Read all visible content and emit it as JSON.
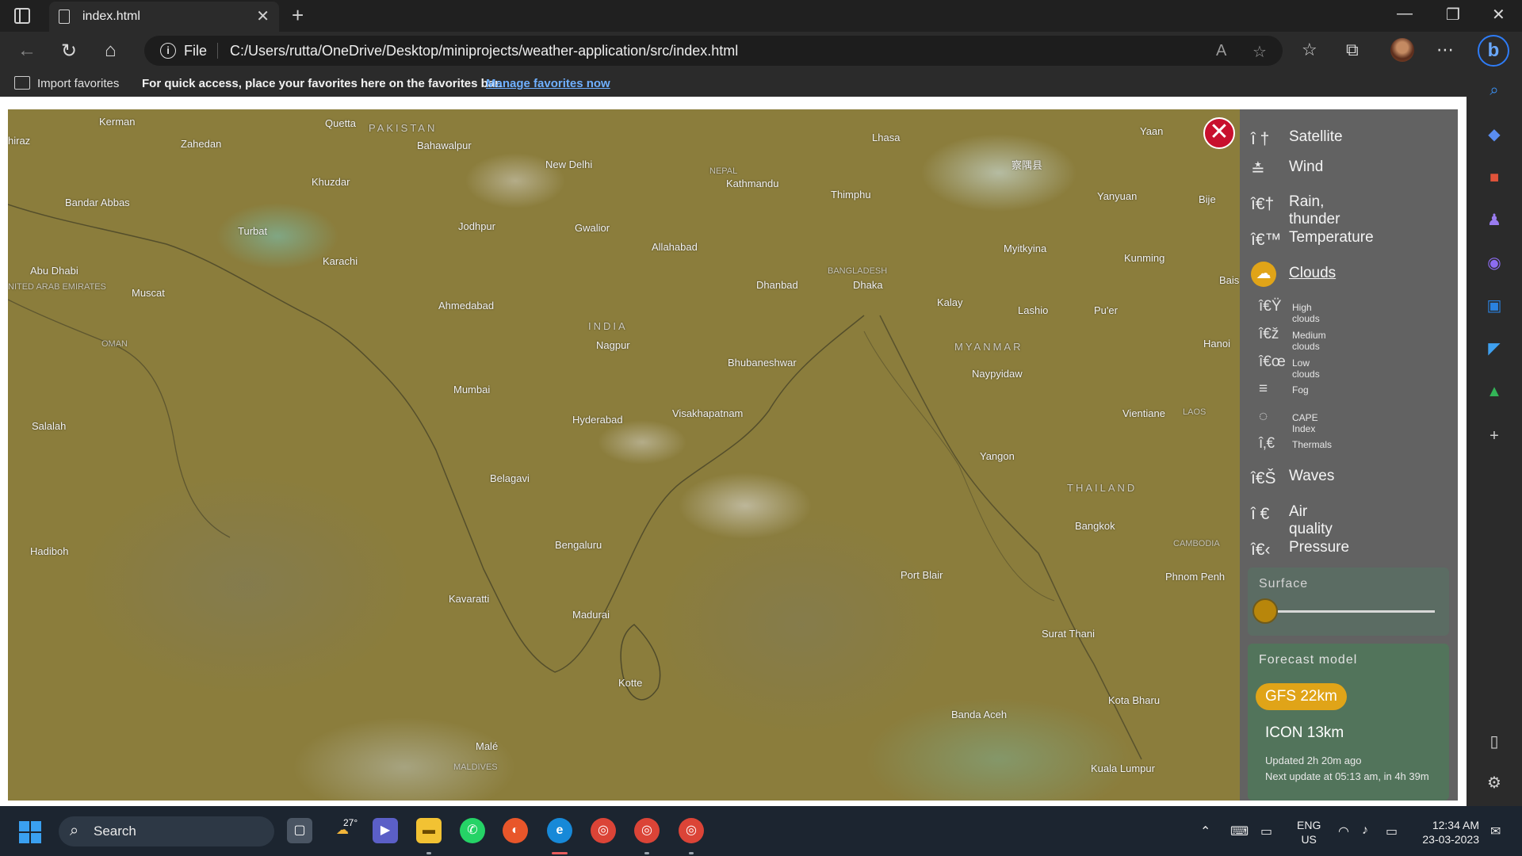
{
  "browser": {
    "tab_title": "index.html",
    "tab_close": "✕",
    "new_tab": "+",
    "window": {
      "minimize": "—",
      "restore": "❐",
      "close": "✕"
    },
    "address": {
      "scheme_label": "File",
      "url": "C:/Users/rutta/OneDrive/Desktop/miniprojects/weather-application/src/index.html"
    },
    "favorites_bar": {
      "import_label": "Import favorites",
      "message": "For quick access, place your favorites here on the favorites bar.",
      "manage_link": "Manage favorites now"
    }
  },
  "map": {
    "close_label": "✕",
    "labels": [
      {
        "text": "Kerman",
        "kind": "city"
      },
      {
        "text": "Quetta",
        "kind": "city"
      },
      {
        "text": "PAKISTAN",
        "kind": "country"
      },
      {
        "text": "hiraz",
        "kind": "city"
      },
      {
        "text": "Zahedan",
        "kind": "city"
      },
      {
        "text": "Bahawalpur",
        "kind": "city"
      },
      {
        "text": "Khuzdar",
        "kind": "city"
      },
      {
        "text": "New Delhi",
        "kind": "city"
      },
      {
        "text": "NEPAL",
        "kind": "small"
      },
      {
        "text": "Kathmandu",
        "kind": "city"
      },
      {
        "text": "Lhasa",
        "kind": "city"
      },
      {
        "text": "察隅县",
        "kind": "city"
      },
      {
        "text": "Yaan",
        "kind": "city"
      },
      {
        "text": "Bandar Abbas",
        "kind": "city"
      },
      {
        "text": "Turbat",
        "kind": "city"
      },
      {
        "text": "Jodhpur",
        "kind": "city"
      },
      {
        "text": "Gwalior",
        "kind": "city"
      },
      {
        "text": "Thimphu",
        "kind": "city"
      },
      {
        "text": "Yanyuan",
        "kind": "city"
      },
      {
        "text": "Bije",
        "kind": "city"
      },
      {
        "text": "Abu Dhabi",
        "kind": "city"
      },
      {
        "text": "Karachi",
        "kind": "city"
      },
      {
        "text": "Allahabad",
        "kind": "city"
      },
      {
        "text": "Myitkyina",
        "kind": "city"
      },
      {
        "text": "Kunming",
        "kind": "city"
      },
      {
        "text": "NITED ARAB EMIRATES",
        "kind": "small"
      },
      {
        "text": "Muscat",
        "kind": "city"
      },
      {
        "text": "BANGLADESH",
        "kind": "small"
      },
      {
        "text": "Dhanbad",
        "kind": "city"
      },
      {
        "text": "Dhaka",
        "kind": "city"
      },
      {
        "text": "Bais",
        "kind": "city"
      },
      {
        "text": "Ahmedabad",
        "kind": "city"
      },
      {
        "text": "Kalay",
        "kind": "city"
      },
      {
        "text": "Lashio",
        "kind": "city"
      },
      {
        "text": "Pu'er",
        "kind": "city"
      },
      {
        "text": "INDIA",
        "kind": "country"
      },
      {
        "text": "OMAN",
        "kind": "small"
      },
      {
        "text": "Nagpur",
        "kind": "city"
      },
      {
        "text": "MYANMAR",
        "kind": "country"
      },
      {
        "text": "Hanoi",
        "kind": "city"
      },
      {
        "text": "Bhubaneshwar",
        "kind": "city"
      },
      {
        "text": "Naypyidaw",
        "kind": "city"
      },
      {
        "text": "Mumbai",
        "kind": "city"
      },
      {
        "text": "Vientiane",
        "kind": "city"
      },
      {
        "text": "LAOS",
        "kind": "small"
      },
      {
        "text": "Salalah",
        "kind": "city"
      },
      {
        "text": "Hyderabad",
        "kind": "city"
      },
      {
        "text": "Visakhapatnam",
        "kind": "city"
      },
      {
        "text": "Yangon",
        "kind": "city"
      },
      {
        "text": "Belagavi",
        "kind": "city"
      },
      {
        "text": "THAILAND",
        "kind": "country"
      },
      {
        "text": "Bangkok",
        "kind": "city"
      },
      {
        "text": "Hadiboh",
        "kind": "city"
      },
      {
        "text": "Bengaluru",
        "kind": "city"
      },
      {
        "text": "CAMBODIA",
        "kind": "small"
      },
      {
        "text": "Port Blair",
        "kind": "city"
      },
      {
        "text": "Phnom Penh",
        "kind": "city"
      },
      {
        "text": "Kavaratti",
        "kind": "city"
      },
      {
        "text": "Madurai",
        "kind": "city"
      },
      {
        "text": "Surat Thani",
        "kind": "city"
      },
      {
        "text": "Kotte",
        "kind": "city"
      },
      {
        "text": "Kota Bharu",
        "kind": "city"
      },
      {
        "text": "Banda Aceh",
        "kind": "city"
      },
      {
        "text": "Malé",
        "kind": "city"
      },
      {
        "text": "MALDIVES",
        "kind": "small"
      },
      {
        "text": "Kuala Lumpur",
        "kind": "city"
      }
    ]
  },
  "layers_menu": {
    "layers": [
      {
        "id": "satellite",
        "icon": "satellite-icon",
        "glyph": "î †",
        "label": "Satellite"
      },
      {
        "id": "wind",
        "icon": "wind-icon",
        "glyph": "≛",
        "label": "Wind"
      },
      {
        "id": "rain",
        "icon": "rain-thunder-icon",
        "glyph": "î€†",
        "label": "Rain, thunder"
      },
      {
        "id": "temperature",
        "icon": "temperature-icon",
        "glyph": "î€™",
        "label": "Temperature"
      },
      {
        "id": "clouds",
        "icon": "clouds-icon",
        "glyph": "☁",
        "label": "Clouds",
        "active": true
      }
    ],
    "sublayers": [
      {
        "id": "high-clouds",
        "icon": "high-clouds-icon",
        "glyph": "î€Ÿ",
        "label": "High clouds"
      },
      {
        "id": "medium-clouds",
        "icon": "medium-clouds-icon",
        "glyph": "î€ž",
        "label": "Medium clouds"
      },
      {
        "id": "low-clouds",
        "icon": "low-clouds-icon",
        "glyph": "î€œ",
        "label": "Low clouds"
      },
      {
        "id": "fog",
        "icon": "fog-icon",
        "glyph": "≡",
        "label": "Fog"
      },
      {
        "id": "cape",
        "icon": "cape-index-icon",
        "glyph": "◌",
        "label": "CAPE Index"
      },
      {
        "id": "thermals",
        "icon": "thermals-icon",
        "glyph": "î‚€",
        "label": "Thermals"
      }
    ],
    "layers_bottom": [
      {
        "id": "waves",
        "icon": "waves-icon",
        "glyph": "î€Š",
        "label": "Waves"
      },
      {
        "id": "air-quality",
        "icon": "air-quality-icon",
        "glyph": "î €",
        "label": "Air quality"
      },
      {
        "id": "pressure",
        "icon": "pressure-icon",
        "glyph": "î€‹",
        "label": "Pressure"
      }
    ],
    "surface": {
      "title": "Surface",
      "slider_level": 0
    },
    "forecast": {
      "title": "Forecast model",
      "options": [
        {
          "label": "GFS 22km",
          "selected": true
        },
        {
          "label": "ICON 13km",
          "selected": false
        }
      ],
      "updated": "Updated 2h 20m ago",
      "next_update": "Next update at 05:13 am, in 4h 39m"
    }
  },
  "taskbar": {
    "search_label": "Search",
    "weather_temp": "27°",
    "language": {
      "line1": "ENG",
      "line2": "US"
    },
    "clock": {
      "time": "12:34 AM",
      "date": "23-03-2023"
    }
  },
  "colors": {
    "map_base": "#8b7d3c",
    "accent_orange": "#e0a418",
    "close_red": "#c8102e",
    "link_blue": "#6fb0ff"
  }
}
